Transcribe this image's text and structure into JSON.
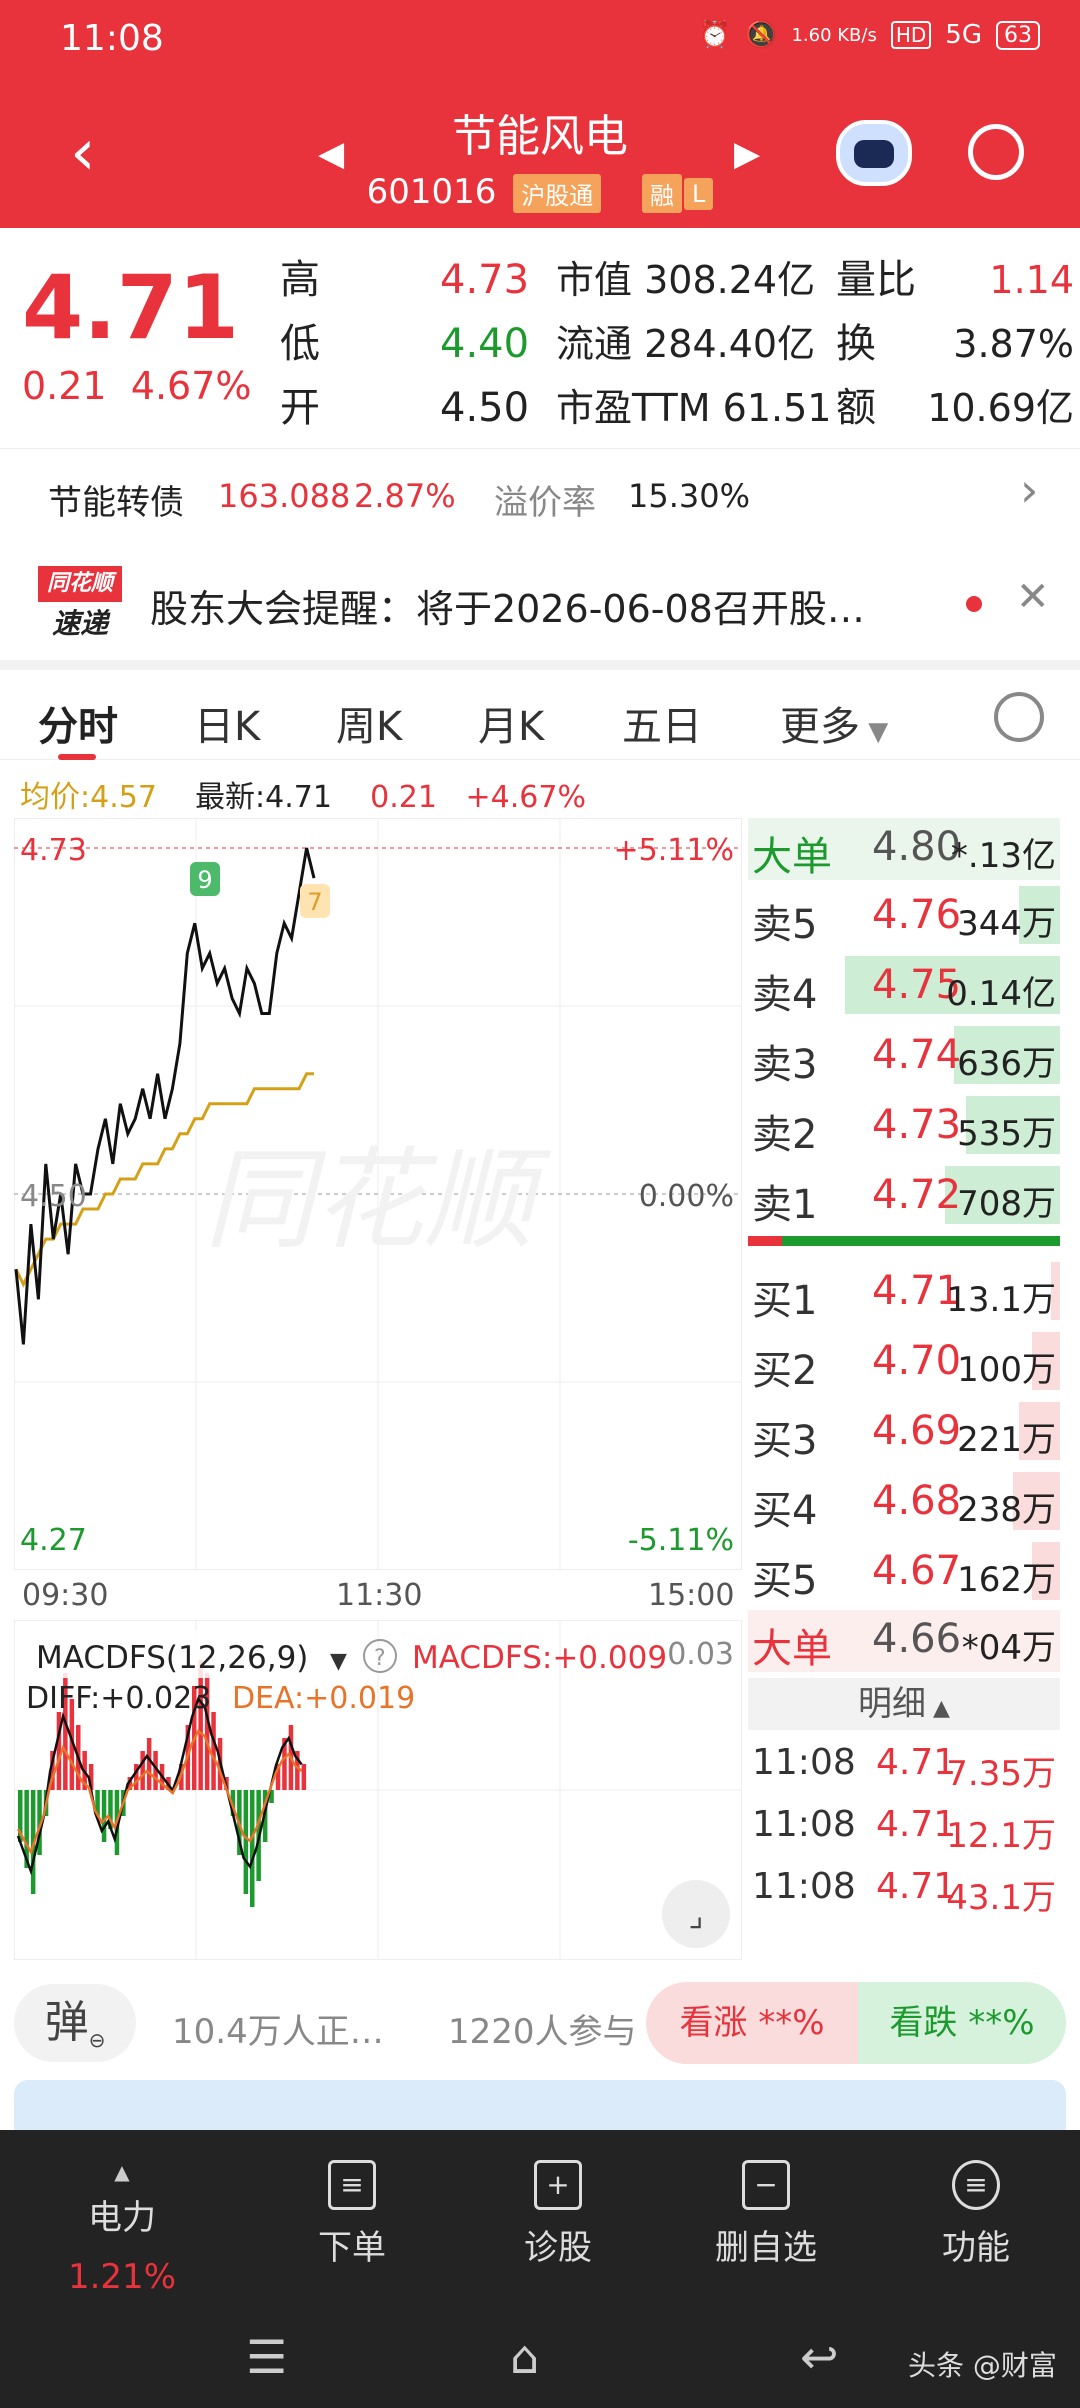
{
  "status": {
    "time": "11:08",
    "net_speed": "1.60 KB/s",
    "signal": "5G",
    "battery": "63"
  },
  "header": {
    "title": "节能风电",
    "code": "601016",
    "tag1": "沪股通",
    "tag2": "融",
    "tag3": "L"
  },
  "quote": {
    "price": "4.71",
    "change": "0.21",
    "change_pct": "4.67%",
    "high_label": "高",
    "high": "4.73",
    "low_label": "低",
    "low": "4.40",
    "open_label": "开",
    "open": "4.50",
    "mcap_label": "市值",
    "mcap": "308.24亿",
    "float_label": "流通",
    "float": "284.40亿",
    "pe_label": "市盈TTM",
    "pe": "61.51",
    "vr_label": "量比",
    "vr": "1.14",
    "turn_label": "换",
    "turn": "3.87%",
    "amt_label": "额",
    "amt": "10.69亿"
  },
  "bond": {
    "name": "节能转债",
    "price": "163.088",
    "pct": "2.87%",
    "premium_label": "溢价率",
    "premium": "15.30%"
  },
  "news": {
    "logo1": "同花顺",
    "logo2": "速递",
    "text": "股东大会提醒：将于2026-06-08召开股…"
  },
  "tabs": [
    "分时",
    "日K",
    "周K",
    "月K",
    "五日",
    "更多"
  ],
  "chart_info": {
    "avg_label": "均价:4.57",
    "latest_label": "最新:4.71",
    "chg": "0.21",
    "pct": "+4.67%"
  },
  "chart_data": {
    "type": "line",
    "y_left_top": "4.73",
    "y_left_mid": "4.50",
    "y_left_bottom": "4.27",
    "y_right_top": "+5.11%",
    "y_right_mid": "0.00%",
    "y_right_bottom": "-5.11%",
    "x_ticks": [
      "09:30",
      "11:30",
      "15:00"
    ],
    "ylim": [
      4.27,
      4.73
    ],
    "price": [
      4.45,
      4.4,
      4.48,
      4.43,
      4.52,
      4.47,
      4.5,
      4.46,
      4.52,
      4.5,
      4.5,
      4.53,
      4.55,
      4.52,
      4.56,
      4.54,
      4.55,
      4.57,
      4.55,
      4.58,
      4.55,
      4.57,
      4.6,
      4.66,
      4.68,
      4.65,
      4.66,
      4.64,
      4.65,
      4.63,
      4.62,
      4.65,
      4.64,
      4.62,
      4.62,
      4.66,
      4.68,
      4.67,
      4.7,
      4.73,
      4.71
    ],
    "avg": [
      4.45,
      4.44,
      4.45,
      4.46,
      4.47,
      4.47,
      4.48,
      4.48,
      4.48,
      4.49,
      4.49,
      4.49,
      4.5,
      4.5,
      4.51,
      4.51,
      4.51,
      4.52,
      4.52,
      4.52,
      4.53,
      4.53,
      4.54,
      4.54,
      4.55,
      4.55,
      4.56,
      4.56,
      4.56,
      4.56,
      4.56,
      4.56,
      4.57,
      4.57,
      4.57,
      4.57,
      4.57,
      4.57,
      4.57,
      4.58,
      4.58
    ],
    "watermark": "同花顺",
    "marker1": "9",
    "marker2": "7"
  },
  "macd": {
    "name": "MACDFS(12,26,9)",
    "value_label": "MACDFS:+0.009",
    "diff": "DIFF:+0.023",
    "dea": "DEA:+0.019",
    "axis_top": "0.03"
  },
  "orderbook": {
    "big_top": {
      "label": "大单",
      "price": "4.80",
      "vol": "*.13亿"
    },
    "asks": [
      {
        "label": "卖5",
        "price": "4.76",
        "vol": "344万",
        "w": 0.15
      },
      {
        "label": "卖4",
        "price": "4.75",
        "vol": "0.14亿",
        "w": 0.95
      },
      {
        "label": "卖3",
        "price": "4.74",
        "vol": "636万",
        "w": 0.45
      },
      {
        "label": "卖2",
        "price": "4.73",
        "vol": "535万",
        "w": 0.4
      },
      {
        "label": "卖1",
        "price": "4.72",
        "vol": "708万",
        "w": 0.5
      }
    ],
    "bids": [
      {
        "label": "买1",
        "price": "4.71",
        "vol": "13.1万",
        "w": 0.02
      },
      {
        "label": "买2",
        "price": "4.70",
        "vol": "100万",
        "w": 0.1
      },
      {
        "label": "买3",
        "price": "4.69",
        "vol": "221万",
        "w": 0.15
      },
      {
        "label": "买4",
        "price": "4.68",
        "vol": "238万",
        "w": 0.18
      },
      {
        "label": "买5",
        "price": "4.67",
        "vol": "162万",
        "w": 0.1
      }
    ],
    "big_bottom": {
      "label": "大单",
      "price": "4.66",
      "vol": "*04万"
    },
    "detail_label": "明细",
    "trades": [
      {
        "time": "11:08",
        "price": "4.71",
        "vol": "7.35万"
      },
      {
        "time": "11:08",
        "price": "4.71",
        "vol": "12.1万"
      },
      {
        "time": "11:08",
        "price": "4.71",
        "vol": "43.1万"
      }
    ]
  },
  "vote": {
    "pop": "弹",
    "watching": "10.4万人正…",
    "participants": "1220人参与",
    "up": "看涨 **%",
    "down": "看跌 **%"
  },
  "bottom": {
    "sector": "电力",
    "sector_pct": "1.21%",
    "order": "下单",
    "diagnose": "诊股",
    "del_fav": "删自选",
    "func": "功能"
  },
  "footer_brand": "头条 @财富",
  "colors": {
    "red": "#e8323c",
    "green": "#1c9a2e",
    "avg_line": "#d4a017"
  }
}
